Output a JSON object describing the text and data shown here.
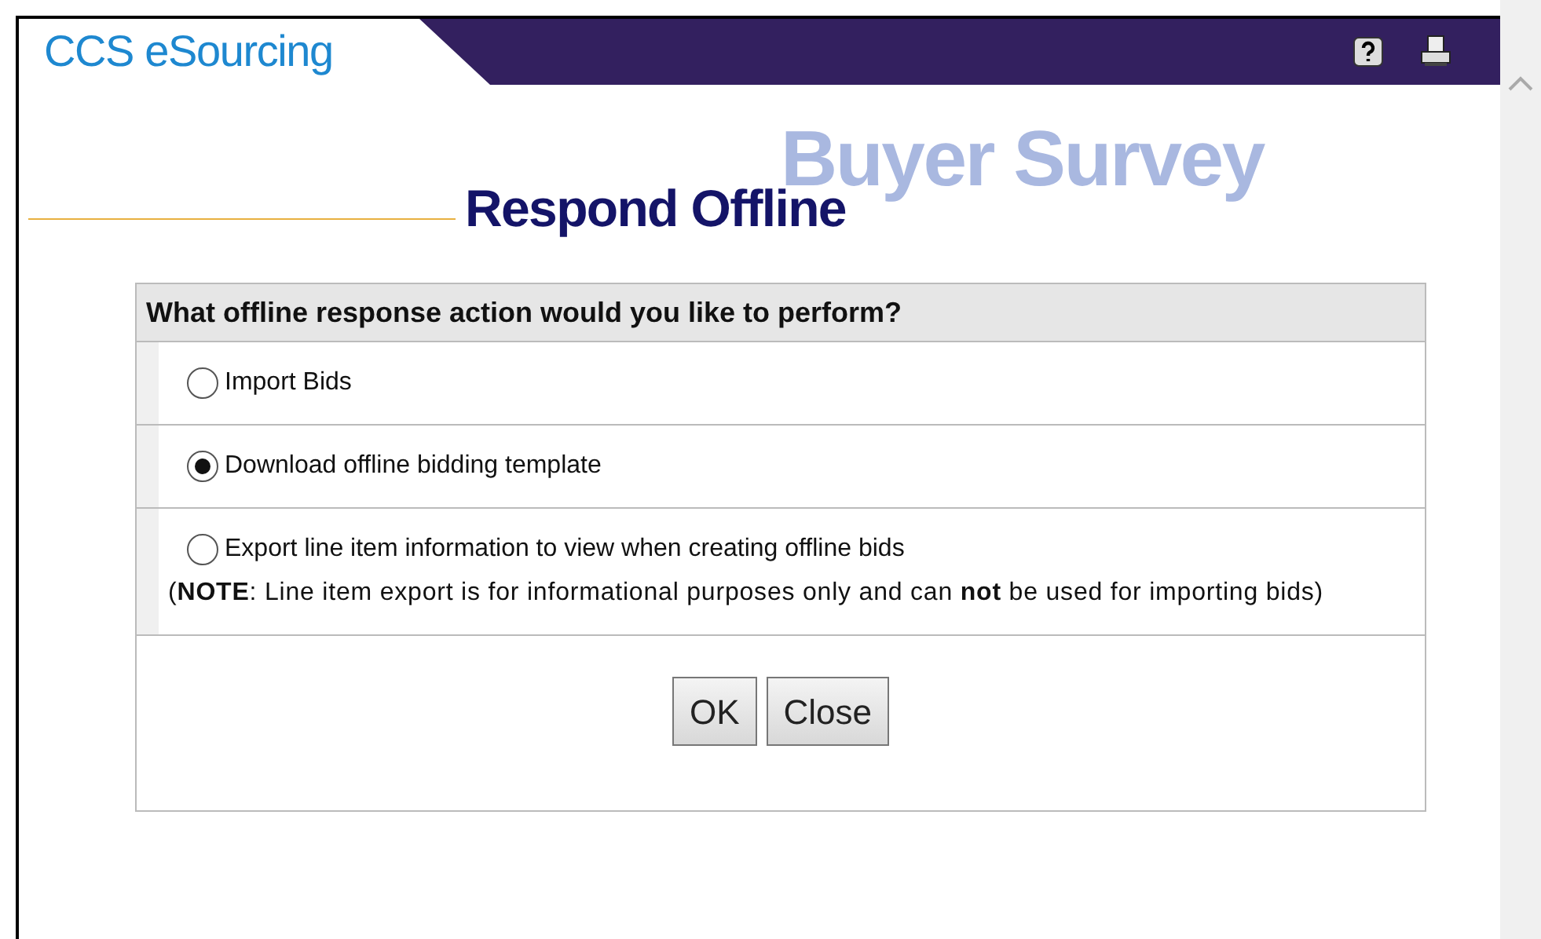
{
  "header": {
    "app_title": "CCS eSourcing",
    "banner_text": "Buyer Survey",
    "page_title": "Respond Offline"
  },
  "form": {
    "question": "What offline response action would you like to perform?",
    "options": [
      {
        "label": "Import Bids",
        "selected": false
      },
      {
        "label": "Download offline bidding template",
        "selected": true
      },
      {
        "label": "Export line item information to view when creating offline bids",
        "selected": false,
        "note": "(**NOTE**: Line item export is for informational purposes only and can **not** be used for importing bids)"
      }
    ],
    "buttons": [
      "OK",
      "Close"
    ]
  }
}
